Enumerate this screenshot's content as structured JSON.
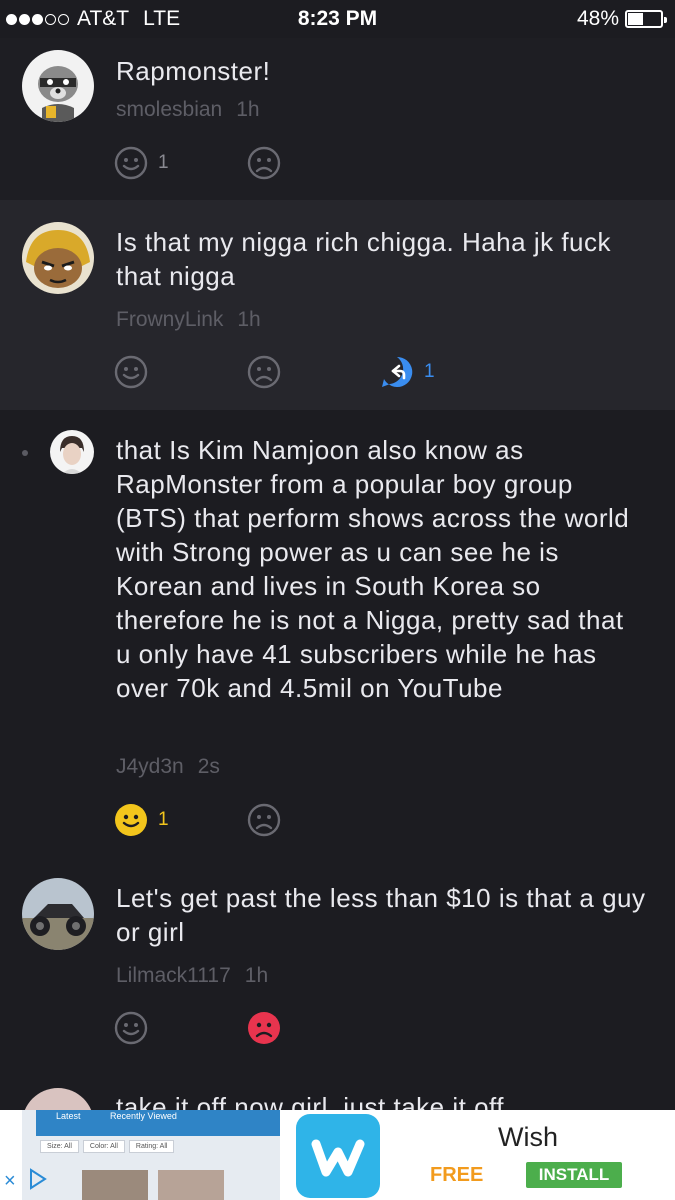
{
  "status_bar": {
    "carrier": "AT&T",
    "network": "LTE",
    "time": "8:23 PM",
    "battery": "48%",
    "battery_level": 0.48,
    "signal_bars_filled": 3,
    "signal_bars_total": 5
  },
  "comments": [
    {
      "text": "Rapmonster!",
      "username": "smolesbian",
      "time": "1h",
      "like_count": "1",
      "dislike_count": "",
      "reply_count": "",
      "liked": false,
      "disliked": false
    },
    {
      "text": "Is that my nigga rich chigga. Haha jk fuck that nigga",
      "username": "FrownyLink",
      "time": "1h",
      "like_count": "",
      "dislike_count": "",
      "reply_count": "1",
      "liked": false,
      "disliked": false
    },
    {
      "text": " that Is Kim Namjoon also know as RapMonster from a popular boy group (BTS) that perform shows across the world with Strong power as u can see he is Korean and lives in South Korea so therefore he is not a Nigga, pretty sad that u only have 41 subscribers while he has over 70k and 4.5mil on YouTube",
      "username": "J4yd3n",
      "time": "2s",
      "like_count": "1",
      "dislike_count": "",
      "reply_count": "",
      "liked": true,
      "disliked": false
    },
    {
      "text": "Let's get past the less than $10 is that a guy or girl",
      "username": "Lilmack1117",
      "time": "1h",
      "like_count": "",
      "dislike_count": "",
      "reply_count": "",
      "liked": false,
      "disliked": true
    },
    {
      "text": "take it off now girl, just take it off"
    }
  ],
  "ad": {
    "screenshot_tabs": [
      "Latest",
      "Recently Viewed"
    ],
    "screenshot_filters": [
      "Size: All",
      "Color: All",
      "Rating: All"
    ],
    "app_name": "Wish",
    "price": "FREE",
    "install_label": "INSTALL",
    "close_icon": "×",
    "colors": {
      "free": "#f29b1d",
      "install": "#4cae4c",
      "wish_icon": "#2fb4e8"
    }
  },
  "colors": {
    "like_active": "#f2c51c",
    "dislike_active": "#e8344e",
    "reply": "#3a8df0",
    "icon_inactive": "#6a6a72"
  }
}
